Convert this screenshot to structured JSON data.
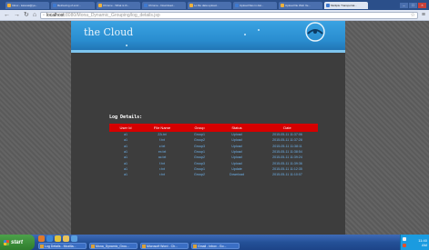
{
  "browser": {
    "tabs": [
      {
        "label": "Inbox - kaiexat@ya...",
        "active": false
      },
      {
        "label": "Retrieving of encr...",
        "active": false
      },
      {
        "label": "Chrome - What is th...",
        "active": false
      },
      {
        "label": "Chrome - Download...",
        "active": false
      },
      {
        "label": "Lo file data upload...",
        "active": false
      },
      {
        "label": "Upload files in dat...",
        "active": false
      },
      {
        "label": "Upload file Web Ve...",
        "active": false
      },
      {
        "label": "Multiple Transportat...",
        "active": true
      }
    ],
    "url_host": "localhost",
    "url_path": ":8080/Mona_Dynamic_Grouping/log_details.jsp"
  },
  "banner": {
    "title": "the Cloud"
  },
  "log": {
    "heading": "Log Details:",
    "columns": [
      "User Id",
      "File Name",
      "Group",
      "Status",
      "Date"
    ],
    "rows": [
      [
        "a1",
        "ZA.txt",
        "Group1",
        "Upload",
        "2015-05-11 11:37:06"
      ],
      [
        "a1",
        "f.txt",
        "Group2",
        "Upload",
        "2015-05-11 11:37:28"
      ],
      [
        "a1",
        "z.txt",
        "Group3",
        "Upload",
        "2015-05-11 11:38:11"
      ],
      [
        "a1",
        "ex.txt",
        "Group1",
        "Upload",
        "2015-05-11 11:38:54"
      ],
      [
        "a1",
        "ac.txt",
        "Group2",
        "Upload",
        "2015-05-11 11:39:24"
      ],
      [
        "a1",
        "f.txt",
        "Group3",
        "Upload",
        "2015-05-11 11:39:36"
      ],
      [
        "a1",
        "r.txt",
        "Group1",
        "Update",
        "2015-05-11 11:12:35"
      ],
      [
        "a1",
        "r.txt",
        "Group2",
        "Download",
        "2015-05-11 11:10:07"
      ]
    ]
  },
  "taskbar": {
    "start_label": "start",
    "items": [
      "Log Details - Mozilla...",
      "Mona_Dynamic_Grou...",
      "Microsoft Word - Ch...",
      "Gmail - Inbox - Go..."
    ],
    "clock_time": "11:40",
    "clock_period": "AM"
  },
  "colors": {
    "table_header": "#d60000",
    "table_text": "#6fb4ee",
    "banner_blue": "#2a8ed0"
  }
}
